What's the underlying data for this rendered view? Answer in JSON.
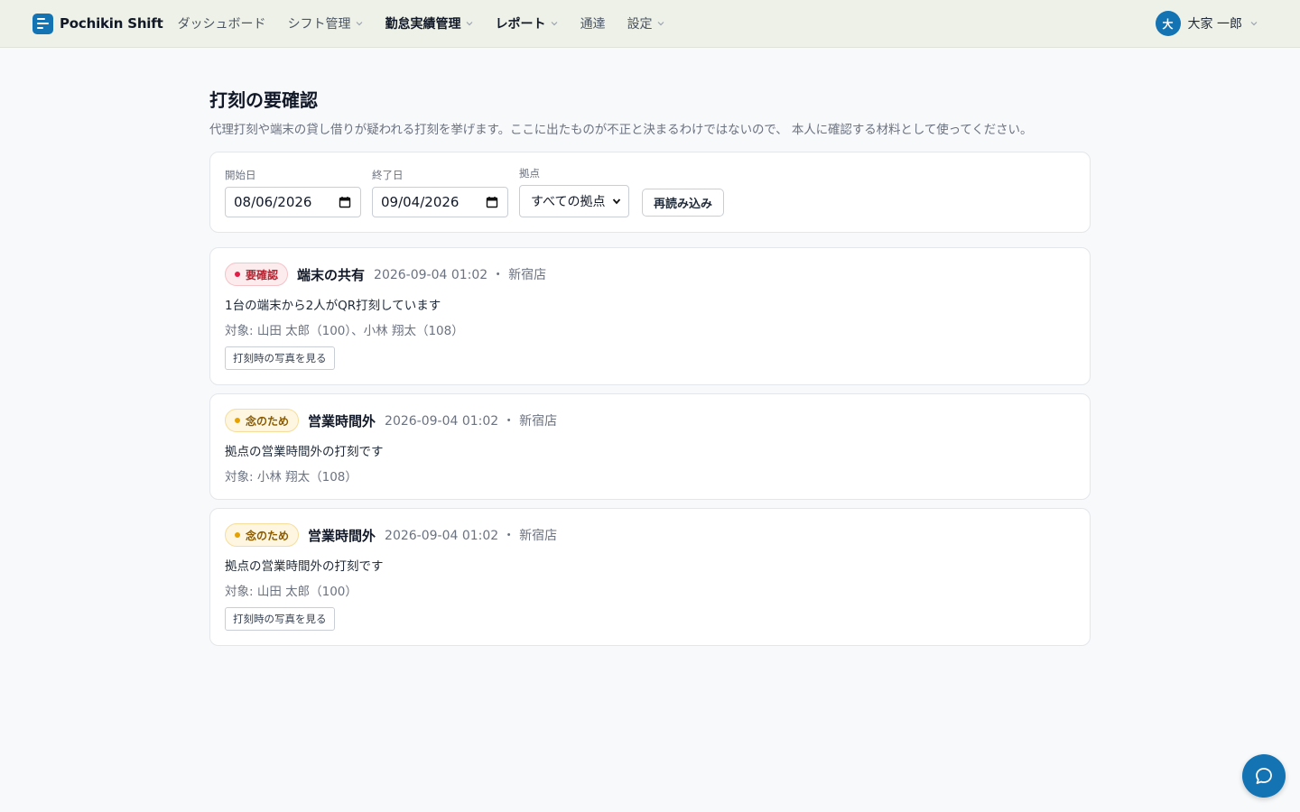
{
  "header": {
    "brand": "Pochikin Shift",
    "nav": [
      {
        "label": "ダッシュボード",
        "dropdown": false,
        "bold": false
      },
      {
        "label": "シフト管理",
        "dropdown": true,
        "bold": false
      },
      {
        "label": "勤怠実績管理",
        "dropdown": true,
        "bold": true
      },
      {
        "label": "レポート",
        "dropdown": true,
        "bold": true
      },
      {
        "label": "通達",
        "dropdown": false,
        "bold": false
      },
      {
        "label": "設定",
        "dropdown": true,
        "bold": false
      }
    ],
    "user": {
      "initial": "大",
      "name": "大家 一郎"
    }
  },
  "page": {
    "title": "打刻の要確認",
    "description": "代理打刻や端末の貸し借りが疑われる打刻を挙げます。ここに出たものが不正と決まるわけではないので、 本人に確認する材料として使ってください。"
  },
  "filters": {
    "start_label": "開始日",
    "start_value": "08/06/2026",
    "end_label": "終了日",
    "end_value": "09/04/2026",
    "location_label": "拠点",
    "location_value": "すべての拠点",
    "reload_label": "再読み込み"
  },
  "alerts": [
    {
      "severity": "critical",
      "badge": "要確認",
      "title": "端末の共有",
      "meta": "2026-09-04 01:02 ・ 新宿店",
      "description": "1台の端末から2人がQR打刻しています",
      "target": "対象: 山田 太郎（100）、小林 翔太（108）",
      "photo_button": "打刻時の写真を見る"
    },
    {
      "severity": "caution",
      "badge": "念のため",
      "title": "営業時間外",
      "meta": "2026-09-04 01:02 ・ 新宿店",
      "description": "拠点の営業時間外の打刻です",
      "target": "対象: 小林 翔太（108）",
      "photo_button": ""
    },
    {
      "severity": "caution",
      "badge": "念のため",
      "title": "営業時間外",
      "meta": "2026-09-04 01:02 ・ 新宿店",
      "description": "拠点の営業時間外の打刻です",
      "target": "対象: 山田 太郎（100）",
      "photo_button": "打刻時の写真を見る"
    }
  ],
  "colors": {
    "brand": "#1473b3",
    "critical": "#e11d48",
    "caution": "#e5a100"
  },
  "icons": {
    "chat_fab": "chat-bubble-icon",
    "date_picker": "calendar-icon",
    "dropdown": "chevron-down-icon"
  }
}
